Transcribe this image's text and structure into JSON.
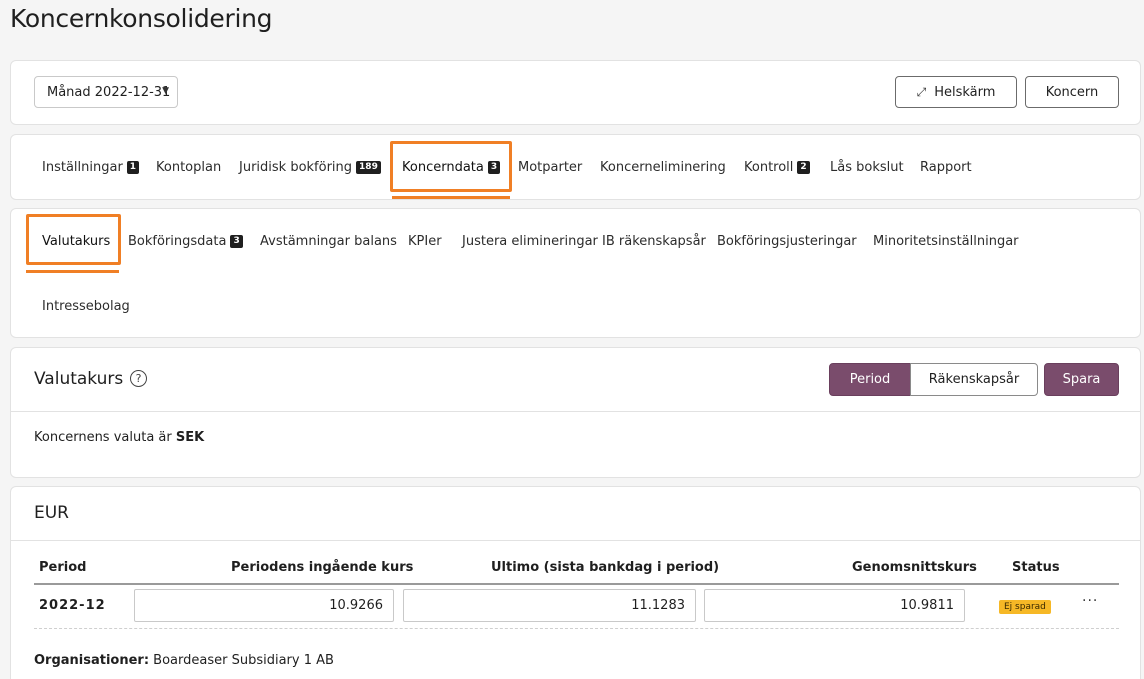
{
  "page": {
    "title": "Koncernkonsolidering"
  },
  "toolbar": {
    "period_select": "Månad 2022-12-31",
    "fullscreen_label": "Helskärm",
    "koncern_label": "Koncern"
  },
  "main_tabs": [
    {
      "label": "Inställningar",
      "badge": "1"
    },
    {
      "label": "Kontoplan",
      "badge": ""
    },
    {
      "label": "Juridisk bokföring",
      "badge": "189"
    },
    {
      "label": "Koncerndata",
      "badge": "3",
      "active": true
    },
    {
      "label": "Motparter",
      "badge": ""
    },
    {
      "label": "Koncerneliminering",
      "badge": ""
    },
    {
      "label": "Kontroll",
      "badge": "2"
    },
    {
      "label": "Lås bokslut",
      "badge": ""
    },
    {
      "label": "Rapport",
      "badge": ""
    }
  ],
  "sub_tabs": [
    {
      "label": "Valutakurs",
      "badge": "",
      "active": true
    },
    {
      "label": "Bokföringsdata",
      "badge": "3"
    },
    {
      "label": "Avstämningar balans",
      "badge": ""
    },
    {
      "label": "KPIer",
      "badge": ""
    },
    {
      "label": "Justera elimineringar IB räkenskapsår",
      "badge": ""
    },
    {
      "label": "Bokföringsjusteringar",
      "badge": ""
    },
    {
      "label": "Minoritetsinställningar",
      "badge": ""
    },
    {
      "label": "Intressebolag",
      "badge": ""
    }
  ],
  "valutakurs": {
    "title": "Valutakurs",
    "help": "?",
    "seg_period": "Period",
    "seg_year": "Räkenskapsår",
    "save_label": "Spara",
    "info_prefix": "Koncernens valuta är ",
    "currency": "SEK"
  },
  "eur": {
    "title": "EUR",
    "headers": {
      "period": "Period",
      "opening": "Periodens ingående kurs",
      "closing": "Ultimo (sista bankdag i period)",
      "average": "Genomsnittskurs",
      "status": "Status"
    },
    "row": {
      "period": "2022-12",
      "opening": "10.9266",
      "closing": "11.1283",
      "average": "10.9811",
      "status": "Ej sparad"
    },
    "org_label": "Organisationer:",
    "org_value": " Boardeaser Subsidiary 1 AB"
  },
  "colors": {
    "accent_orange": "#f07f25",
    "primary_purple": "#7a4c6c",
    "status_yellow": "#f6b826"
  }
}
